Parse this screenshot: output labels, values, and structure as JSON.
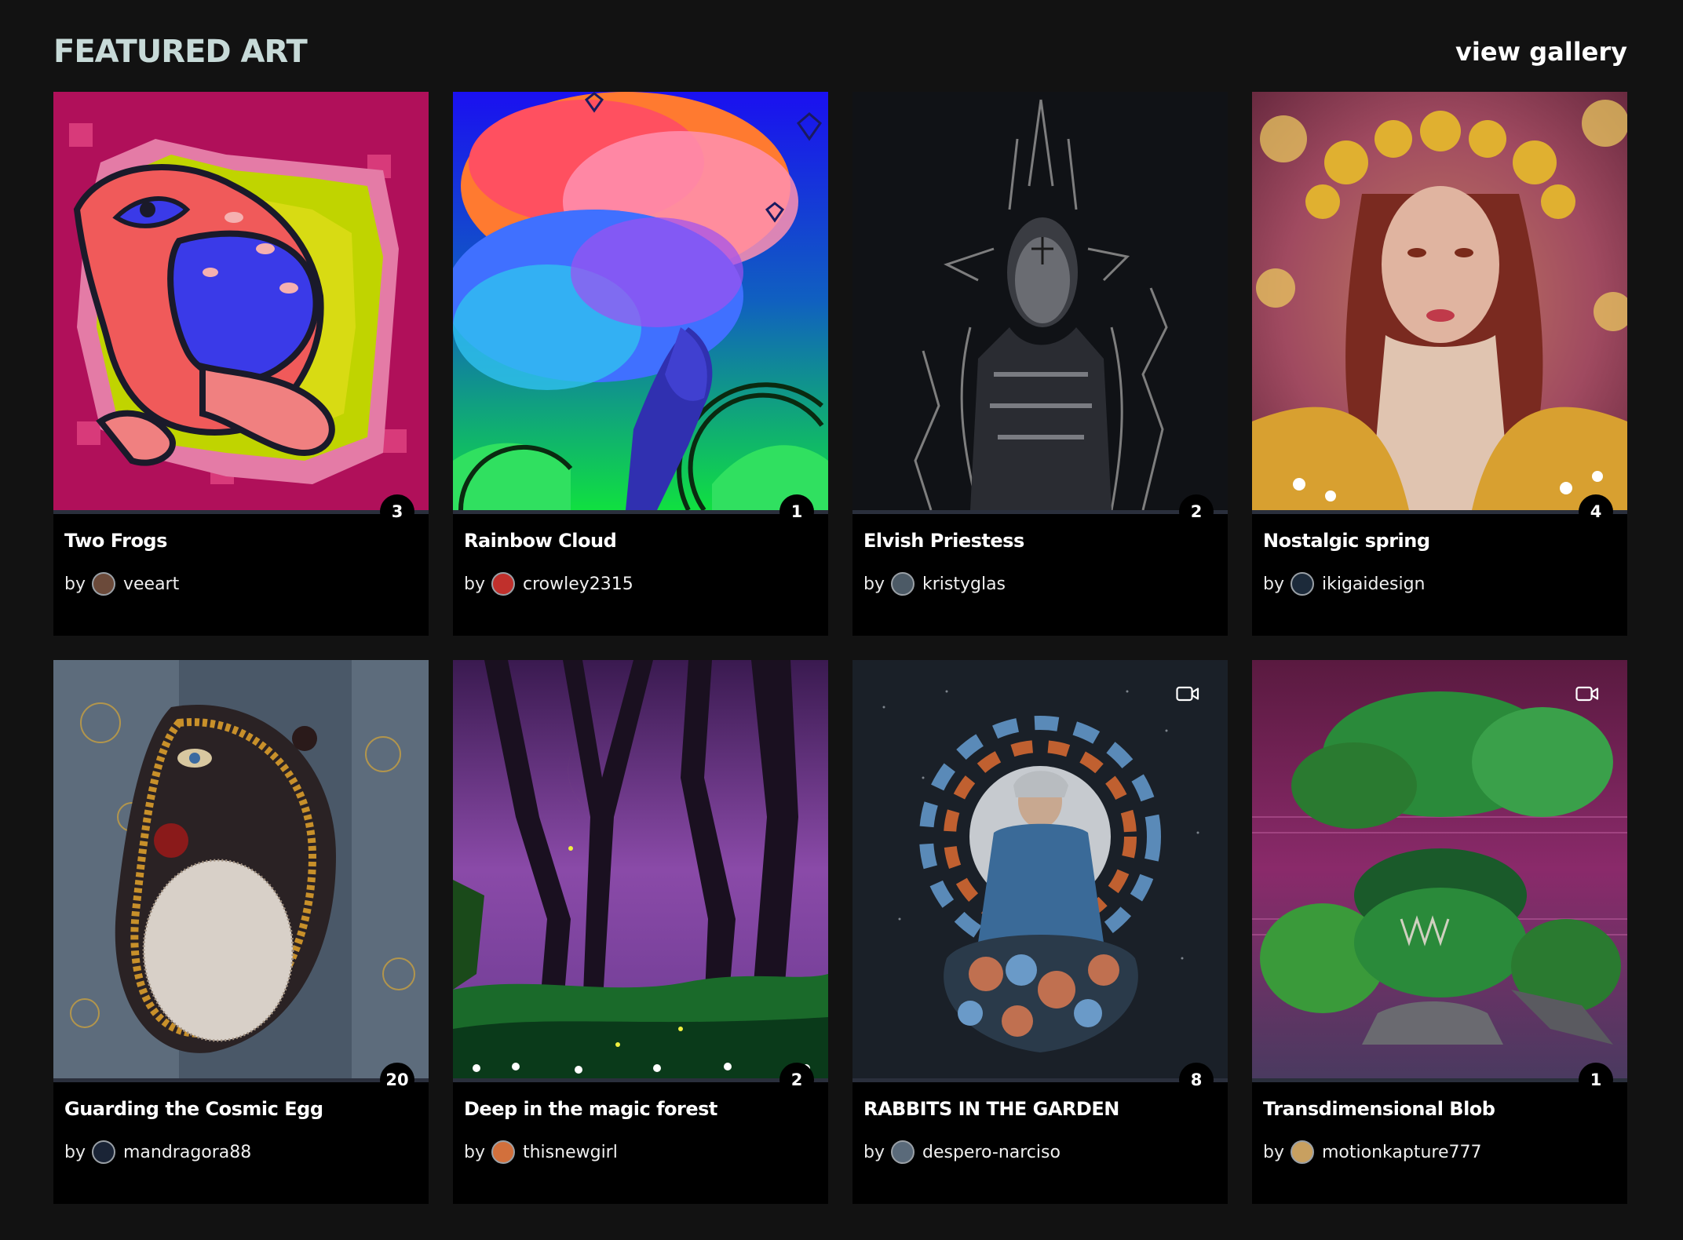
{
  "header": {
    "title": "FEATURED ART",
    "view_gallery": "view gallery"
  },
  "cards": [
    {
      "title": "Two Frogs",
      "by": "by",
      "artist": "veeart",
      "count": "3",
      "avatar_color": "#6b4a3a",
      "video": false
    },
    {
      "title": "Rainbow Cloud",
      "by": "by",
      "artist": "crowley2315",
      "count": "1",
      "avatar_color": "#c0302c",
      "video": false
    },
    {
      "title": "Elvish Priestess",
      "by": "by",
      "artist": "kristyglas",
      "count": "2",
      "avatar_color": "#4c5a66",
      "video": false
    },
    {
      "title": "Nostalgic spring",
      "by": "by",
      "artist": "ikigaidesign",
      "count": "4",
      "avatar_color": "#1c2a3a",
      "video": false
    },
    {
      "title": "Guarding the Cosmic Egg",
      "by": "by",
      "artist": "mandragora88",
      "count": "20",
      "avatar_color": "#1a2436",
      "video": false
    },
    {
      "title": "Deep in the magic forest",
      "by": "by",
      "artist": "thisnewgirl",
      "count": "2",
      "avatar_color": "#d2703c",
      "video": false
    },
    {
      "title": "RABBITS IN THE GARDEN",
      "by": "by",
      "artist": "despero-narciso",
      "count": "8",
      "avatar_color": "#5a6a7a",
      "video": true
    },
    {
      "title": "Transdimensional Blob",
      "by": "by",
      "artist": "motionkapture777",
      "count": "1",
      "avatar_color": "#c8a060",
      "video": true
    }
  ]
}
